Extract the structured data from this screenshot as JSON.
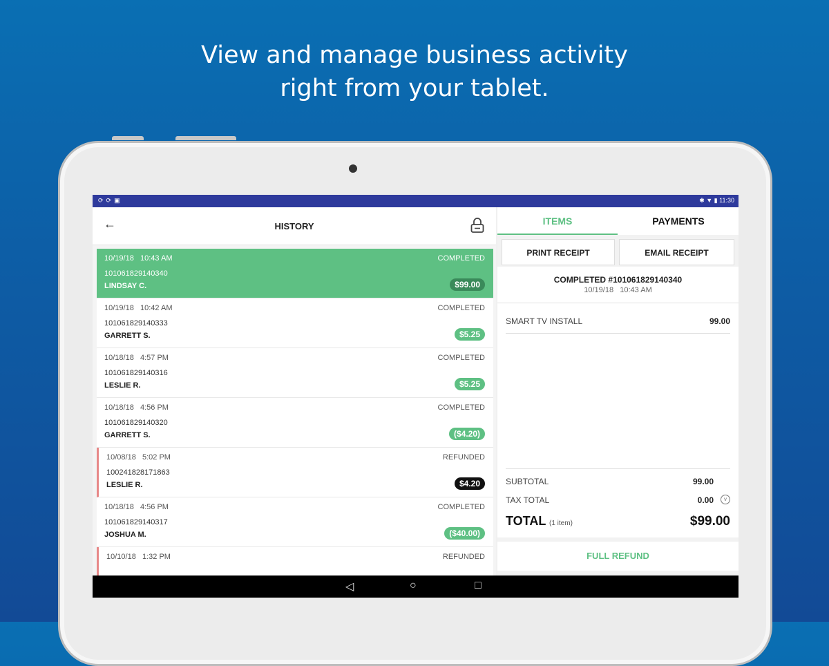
{
  "headline": {
    "line1": "View and manage business activity",
    "line2": "right from your tablet."
  },
  "statusbar": {
    "left_icons": [
      "sync-icon",
      "sync-icon",
      "image-icon"
    ],
    "time": "11:30"
  },
  "history": {
    "title": "HISTORY",
    "transactions": [
      {
        "date": "10/19/18",
        "time": "10:43 AM",
        "status": "COMPLETED",
        "id": "101061829140340",
        "customer": "LINDSAY C.",
        "amount": "$99.00",
        "selected": true
      },
      {
        "date": "10/19/18",
        "time": "10:42 AM",
        "status": "COMPLETED",
        "id": "101061829140333",
        "customer": "GARRETT S.",
        "amount": "$5.25",
        "selected": false
      },
      {
        "date": "10/18/18",
        "time": "4:57 PM",
        "status": "COMPLETED",
        "id": "101061829140316",
        "customer": "LESLIE R.",
        "amount": "$5.25",
        "selected": false
      },
      {
        "date": "10/18/18",
        "time": "4:56 PM",
        "status": "COMPLETED",
        "id": "101061829140320",
        "customer": "GARRETT S.",
        "amount": "($4.20)",
        "selected": false
      },
      {
        "date": "10/08/18",
        "time": "5:02 PM",
        "status": "REFUNDED",
        "id": "100241828171863",
        "customer": "LESLIE R.",
        "amount": "$4.20",
        "selected": false
      },
      {
        "date": "10/18/18",
        "time": "4:56 PM",
        "status": "COMPLETED",
        "id": "101061829140317",
        "customer": "JOSHUA M.",
        "amount": "($40.00)",
        "selected": false
      },
      {
        "date": "10/10/18",
        "time": "1:32 PM",
        "status": "REFUNDED",
        "id": "",
        "customer": "",
        "amount": "",
        "selected": false
      }
    ]
  },
  "detail": {
    "tabs": [
      "ITEMS",
      "PAYMENTS"
    ],
    "print_receipt": "PRINT RECEIPT",
    "email_receipt": "EMAIL RECEIPT",
    "receipt_title": "COMPLETED #101061829140340",
    "receipt_date": "10/19/18   10:43 AM",
    "item_name": "SMART TV INSTALL",
    "item_value": "99.00",
    "subtotal_label": "SUBTOTAL",
    "subtotal_value": "99.00",
    "tax_label": "TAX TOTAL",
    "tax_value": "0.00",
    "total_label": "TOTAL",
    "total_items": "(1 item)",
    "total_value": "$99.00",
    "full_refund": "FULL REFUND"
  },
  "colors": {
    "accent_green": "#5ec083",
    "status_bar": "#2e3a9c",
    "background_blue": "#0d5ea6"
  }
}
